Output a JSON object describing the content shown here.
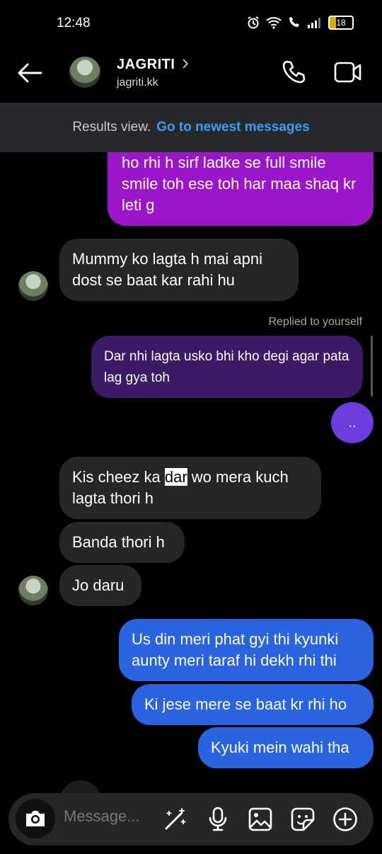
{
  "status": {
    "time": "12:48",
    "battery": "18"
  },
  "header": {
    "name": "JAGRITI",
    "username": "jagriti.kk"
  },
  "banner": {
    "results_label": "Results view.",
    "newest_link": "Go to newest messages"
  },
  "messages": {
    "m1": "ho rhi h sirf ladke se full smile smile toh ese toh har maa shaq kr leti g",
    "m2": "Mummy ko lagta h mai apni dost se baat kar rahi hu",
    "replied_label": "Replied to yourself",
    "m3": "Dar nhi lagta usko bhi kho degi agar pata lag gya toh",
    "m4": "..",
    "m5_pre": "Kis cheez ka ",
    "m5_hl": "dar",
    "m5_post": " wo mera kuch lagta thori h",
    "m6": "Banda thori h",
    "m7": "Jo daru",
    "m8": "Us din meri phat gyi thi kyunki aunty meri taraf hi dekh rhi thi",
    "m9": "Ki jese mere se baat kr rhi ho",
    "m10": "Kyuki mein wahi tha"
  },
  "composer": {
    "placeholder": "Message..."
  },
  "colors": {
    "accent_link": "#3b9cf5",
    "bubble_purple": "#9b16c9",
    "bubble_blue": "#2a63e0",
    "bubble_dark_purple": "#3b1a66",
    "bubble_incoming": "#262626"
  }
}
